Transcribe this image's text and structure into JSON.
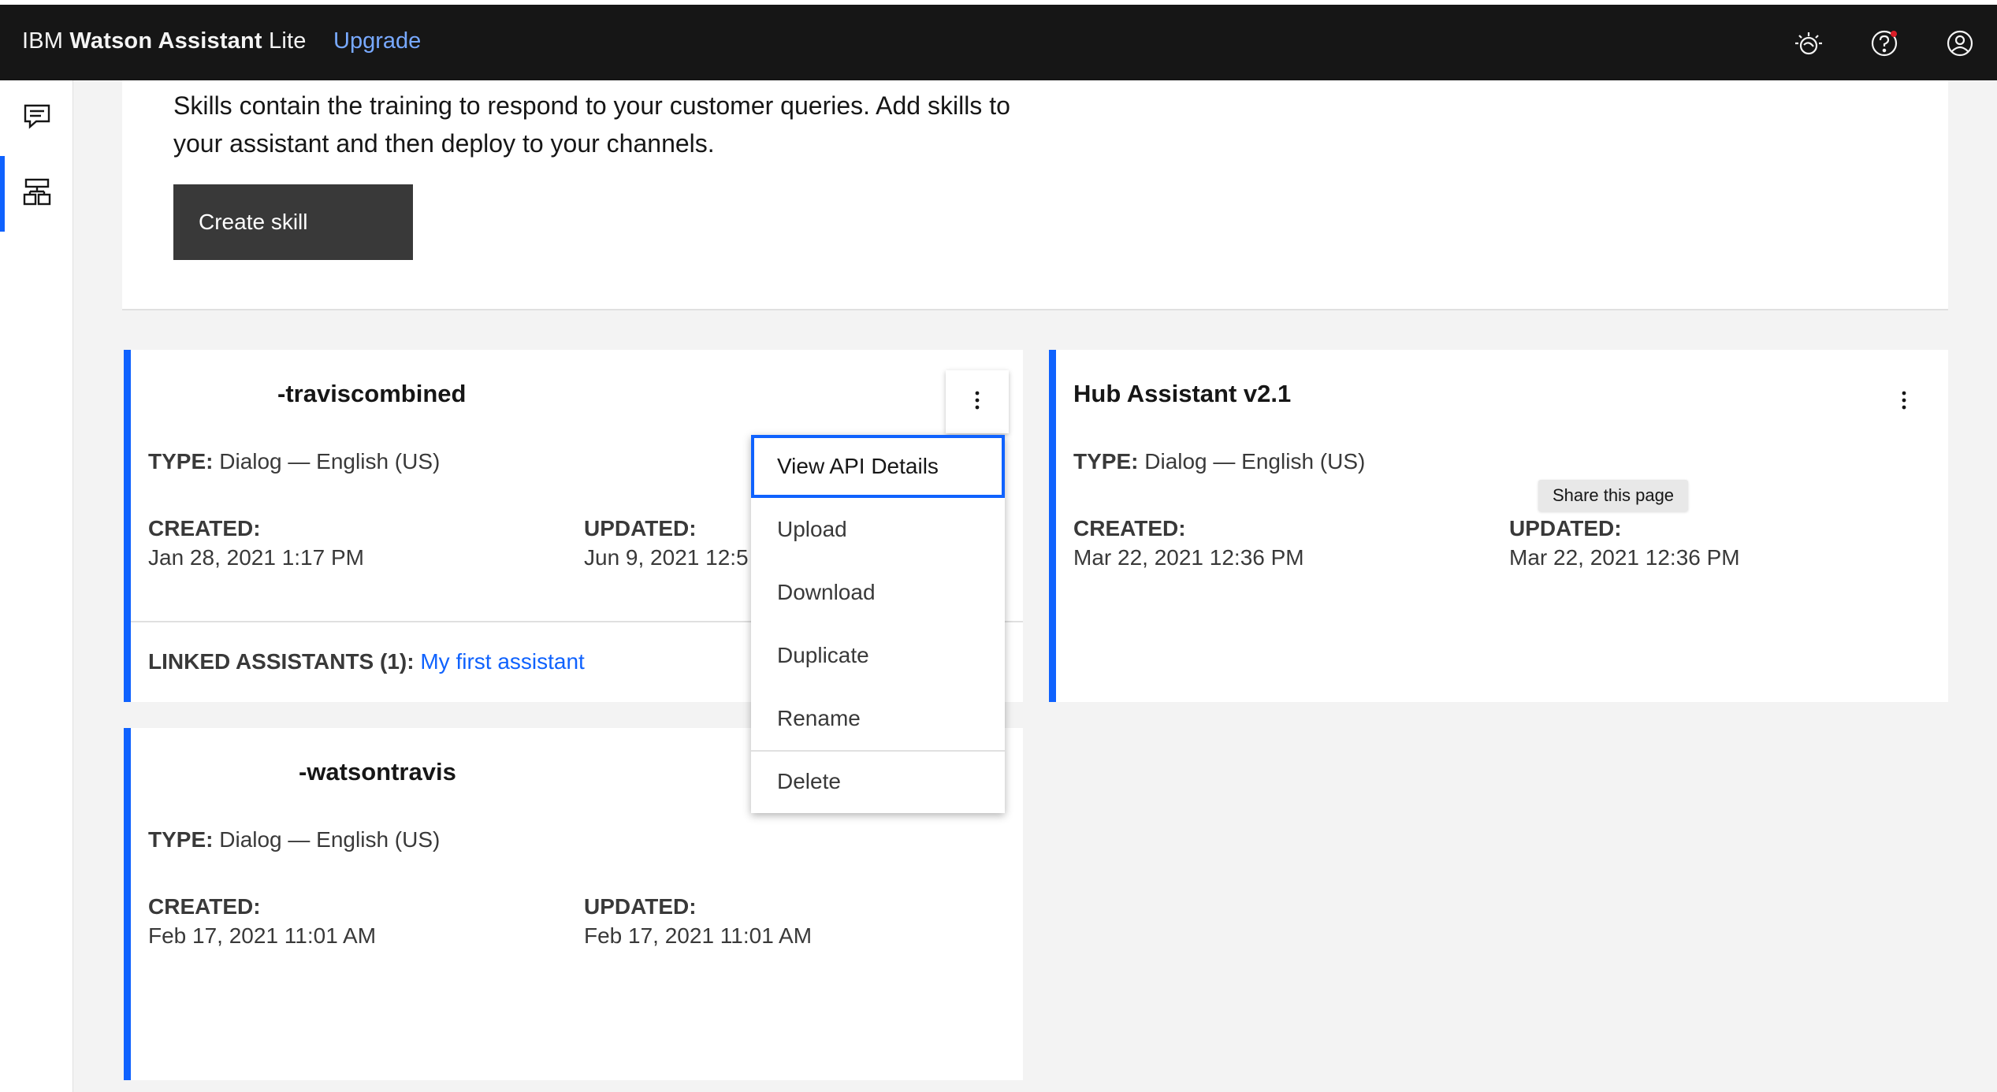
{
  "header": {
    "brand_prefix": "IBM ",
    "brand_product": "Watson Assistant",
    "brand_suffix": " Lite",
    "upgrade_label": "Upgrade",
    "icons": [
      "watson-bulb-icon",
      "help-icon",
      "user-profile-icon"
    ],
    "notification_color": "#da1e28"
  },
  "sidebar": {
    "items": [
      {
        "icon": "assistants-chat-icon",
        "active": false
      },
      {
        "icon": "skills-icon",
        "active": true
      }
    ],
    "accent": "#0f62fe"
  },
  "intro": {
    "text": "Skills contain the training to respond to your customer queries. Add skills to your assistant and then deploy to your channels.",
    "create_label": "Create skill"
  },
  "cards": [
    {
      "title": "-traviscombined",
      "type_label": "TYPE:",
      "type_value": " Dialog — English (US)",
      "created_label": "CREATED:",
      "created_value": "Jan 28, 2021 1:17 PM",
      "updated_label": "UPDATED:",
      "updated_value": "Jun 9, 2021 12:5",
      "linked_label": "LINKED ASSISTANTS (1):",
      "linked_value": "My first assistant"
    },
    {
      "title": "Hub Assistant v2.1",
      "type_label": "TYPE:",
      "type_value": " Dialog — English (US)",
      "created_label": "CREATED:",
      "created_value": "Mar 22, 2021 12:36 PM",
      "updated_label": "UPDATED:",
      "updated_value": "Mar 22, 2021 12:36 PM"
    },
    {
      "title": "-watsontravis",
      "type_label": "TYPE:",
      "type_value": " Dialog — English (US)",
      "created_label": "CREATED:",
      "created_value": "Feb 17, 2021 11:01 AM",
      "updated_label": "UPDATED:",
      "updated_value": "Feb 17, 2021 11:01 AM"
    }
  ],
  "overflow_menu": {
    "items": [
      "View API Details",
      "Upload",
      "Download",
      "Duplicate",
      "Rename",
      "Delete"
    ],
    "focused": "View API Details"
  },
  "tooltip": {
    "text": "Share this page"
  }
}
